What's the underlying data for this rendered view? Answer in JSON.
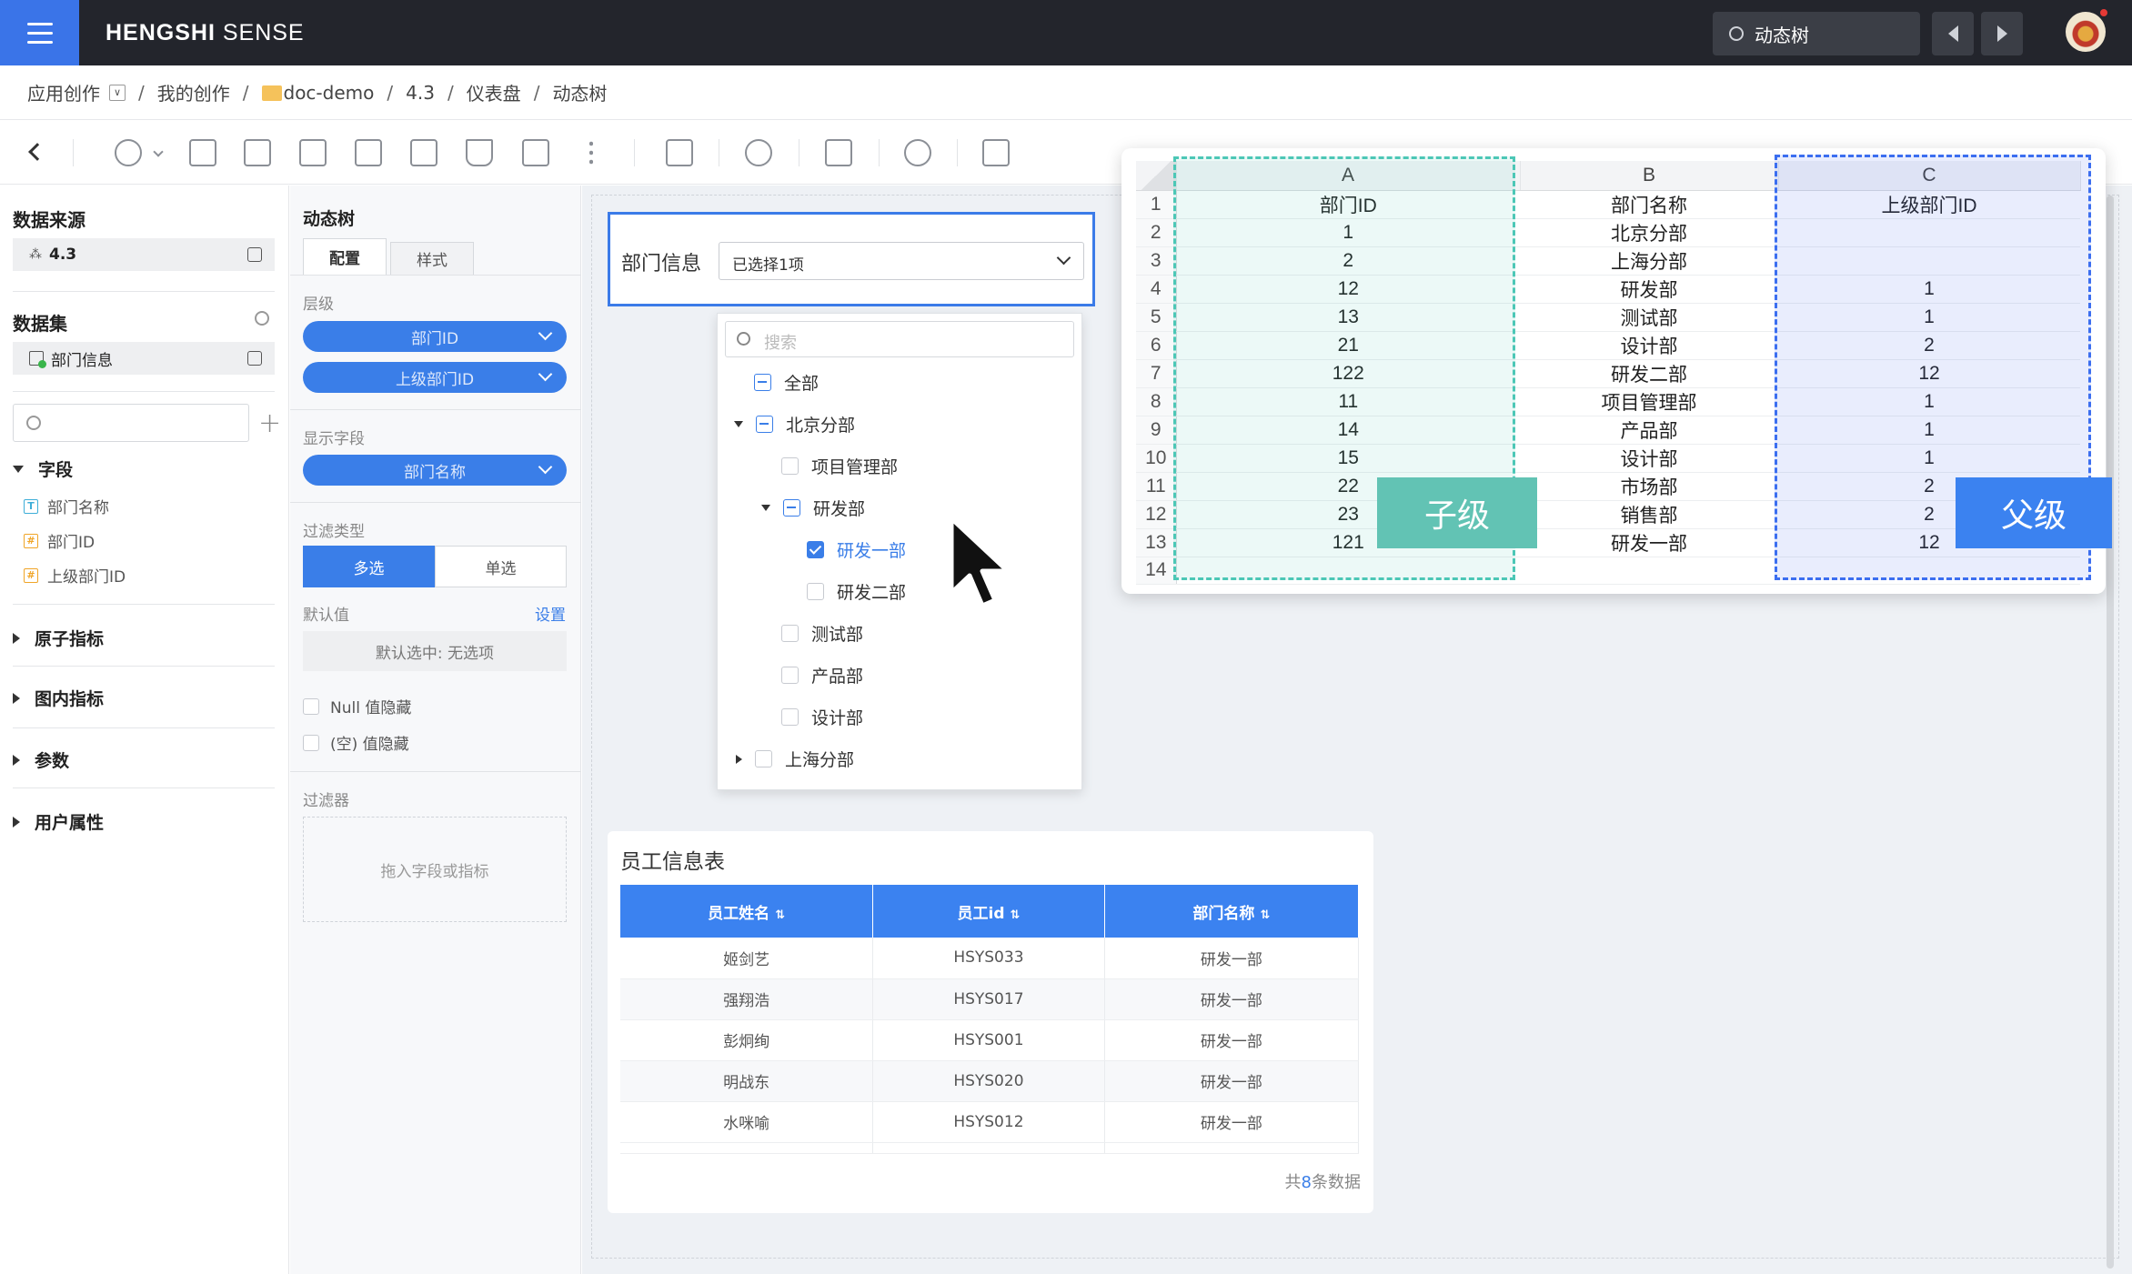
{
  "topbar": {
    "brand_bold": "HENGSHI",
    "brand_rest": " SENSE",
    "dashboard_name": "动态树"
  },
  "breadcrumb": [
    "应用创作",
    "我的创作",
    "doc-demo",
    "4.3",
    "仪表盘",
    "动态树"
  ],
  "left_panel": {
    "datasource_title": "数据来源",
    "datasource_item": "4.3",
    "dataset_title": "数据集",
    "dataset_item": "部门信息",
    "fields_group": "字段",
    "fields": [
      {
        "name": "部门名称",
        "type": "T"
      },
      {
        "name": "部门ID",
        "type": "#"
      },
      {
        "name": "上级部门ID",
        "type": "#"
      }
    ],
    "groups": [
      "原子指标",
      "图内指标",
      "参数",
      "用户属性"
    ]
  },
  "config_panel": {
    "title": "动态树",
    "tabs": [
      "配置",
      "样式"
    ],
    "level_label": "层级",
    "level_fields": [
      "部门ID",
      "上级部门ID"
    ],
    "display_label": "显示字段",
    "display_field": "部门名称",
    "filter_type_label": "过滤类型",
    "filter_types": [
      "多选",
      "单选"
    ],
    "default_label": "默认值",
    "default_set": "设置",
    "default_value": "默认选中: 无选项",
    "null_hide": "Null 值隐藏",
    "empty_hide": "(空) 值隐藏",
    "filters_label": "过滤器",
    "drop_hint": "拖入字段或指标"
  },
  "filter_widget": {
    "title": "部门信息",
    "selected": "已选择1项",
    "search_placeholder": "搜索",
    "tree": [
      {
        "label": "全部",
        "state": "partial"
      },
      {
        "label": "北京分部",
        "state": "partial"
      },
      {
        "label": "项目管理部",
        "state": "none"
      },
      {
        "label": "研发部",
        "state": "partial"
      },
      {
        "label": "研发一部",
        "state": "checked"
      },
      {
        "label": "研发二部",
        "state": "none"
      },
      {
        "label": "测试部",
        "state": "none"
      },
      {
        "label": "产品部",
        "state": "none"
      },
      {
        "label": "设计部",
        "state": "none"
      },
      {
        "label": "上海分部",
        "state": "none"
      }
    ]
  },
  "employee_table": {
    "title": "员工信息表",
    "columns": [
      "员工姓名",
      "员工id",
      "部门名称"
    ],
    "rows": [
      [
        "姬剑艺",
        "HSYS033",
        "研发一部"
      ],
      [
        "强翔浩",
        "HSYS017",
        "研发一部"
      ],
      [
        "彭炯绚",
        "HSYS001",
        "研发一部"
      ],
      [
        "明战东",
        "HSYS020",
        "研发一部"
      ],
      [
        "水咪喻",
        "HSYS012",
        "研发一部"
      ]
    ],
    "footer_prefix": "共",
    "footer_count": "8",
    "footer_suffix": "条数据"
  },
  "spreadsheet": {
    "columns": [
      "A",
      "B",
      "C"
    ],
    "rows": [
      [
        "部门ID",
        "部门名称",
        "上级部门ID"
      ],
      [
        "1",
        "北京分部",
        ""
      ],
      [
        "2",
        "上海分部",
        ""
      ],
      [
        "12",
        "研发部",
        "1"
      ],
      [
        "13",
        "测试部",
        "1"
      ],
      [
        "21",
        "设计部",
        "2"
      ],
      [
        "122",
        "研发二部",
        "12"
      ],
      [
        "11",
        "项目管理部",
        "1"
      ],
      [
        "14",
        "产品部",
        "1"
      ],
      [
        "15",
        "设计部",
        "1"
      ],
      [
        "22",
        "市场部",
        "2"
      ],
      [
        "23",
        "销售部",
        "2"
      ],
      [
        "121",
        "研发一部",
        "12"
      ],
      [
        "",
        "",
        ""
      ]
    ],
    "child_tag": "子级",
    "parent_tag": "父级"
  },
  "colors": {
    "accent": "#3a7ee8",
    "topbar": "#23252c",
    "child_highlight": "#4cc7b6",
    "parent_highlight": "#3b6ef0"
  }
}
